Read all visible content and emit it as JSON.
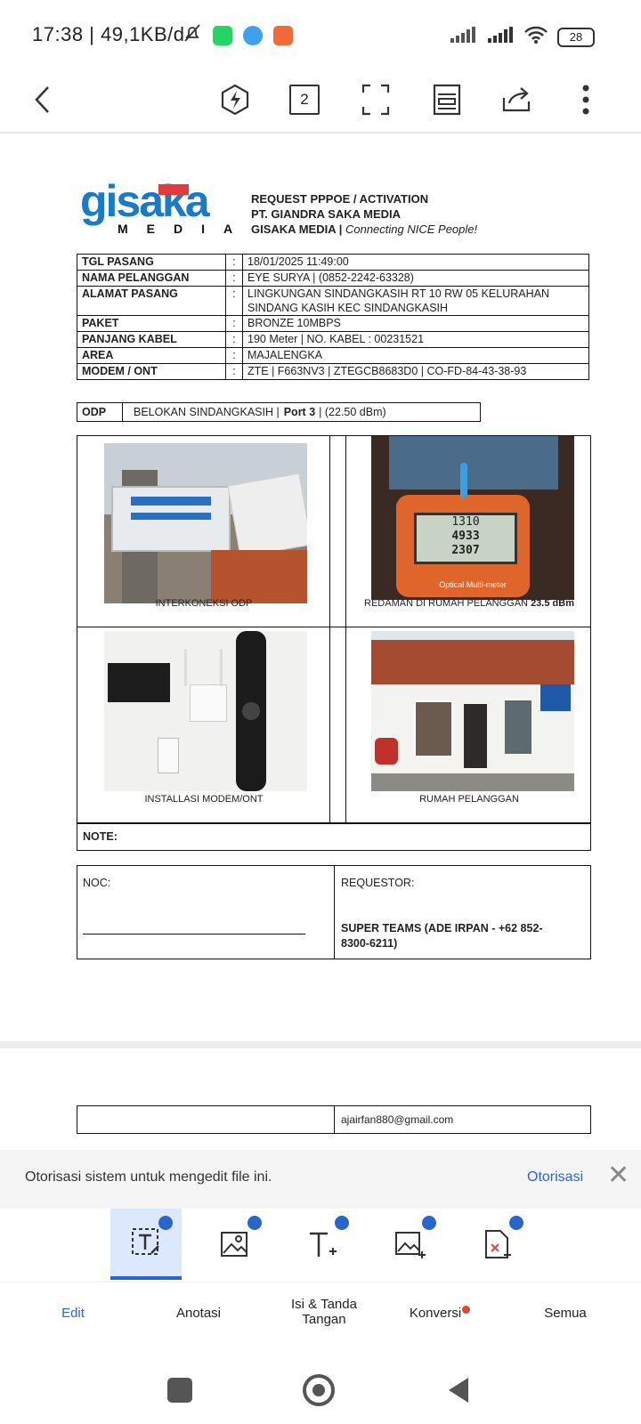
{
  "status_bar": {
    "time": "17:38 | 49,1KB/d",
    "battery": "28"
  },
  "toolbar": {
    "page_count": "2"
  },
  "document": {
    "logo_text": "gisaka",
    "logo_sub": "MEDIA",
    "header_line1": "REQUEST PPPOE / ACTIVATION",
    "header_line2": "PT. GIANDRA SAKA MEDIA",
    "header_line3_bold": "GISAKA MEDIA |",
    "header_line3_italic": "Connecting NICE People!",
    "fields": [
      {
        "label": "TGL PASANG",
        "value": "18/01/2025 11:49:00"
      },
      {
        "label": "NAMA PELANGGAN",
        "value": "EYE SURYA | (0852-2242-63328)"
      },
      {
        "label": "ALAMAT PASANG",
        "value": "LINGKUNGAN SINDANGKASIH RT 10 RW 05 KELURAHAN SINDANG KASIH KEC SINDANGKASIH"
      },
      {
        "label": "PAKET",
        "value": "BRONZE 10MBPS"
      },
      {
        "label": "PANJANG KABEL",
        "value": "190  Meter  | NO. KABEL : 00231521"
      },
      {
        "label": "AREA",
        "value": "MAJALENGKA"
      },
      {
        "label": "MODEM / ONT",
        "value": "ZTE |  F663NV3 | ZTEGCB8683D0 |  CO-FD-84-43-38-93"
      }
    ],
    "odp_label": "ODP",
    "odp_value": "BELOKAN SINDANGKASIH |",
    "odp_port": "Port 3",
    "odp_power": "|  (22.50 dBm)",
    "photo_captions": [
      "INTERKONEKSI ODP",
      "REDAMAN DI RUMAH PELANGGAN",
      "INSTALLASI MODEM/ONT",
      "RUMAH PELANGGAN"
    ],
    "redaman_value": "23.5 dBm",
    "meter_reading_1": "1310",
    "meter_reading_2": "4933",
    "meter_reading_3": "2307",
    "meter_brand": "Optical Multi-meter",
    "note_label": "NOTE:",
    "noc_label": "NOC:",
    "requestor_label": "REQUESTOR:",
    "requestor_name": "SUPER TEAMS (ADE IRPAN - +62 852-8300-6211)",
    "page2_email": "ajairfan880@gmail.com"
  },
  "banner": {
    "message": "Otorisasi sistem untuk mengedit file ini.",
    "action": "Otorisasi"
  },
  "bottom_tabs": [
    {
      "label": "Edit"
    },
    {
      "label": "Anotasi"
    },
    {
      "label": "Isi & Tanda Tangan"
    },
    {
      "label": "Konversi"
    },
    {
      "label": "Semua"
    }
  ],
  "colors": {
    "accent": "#2a66c7",
    "logo_blue": "#1a7ac4",
    "logo_red": "#e23b3b"
  }
}
